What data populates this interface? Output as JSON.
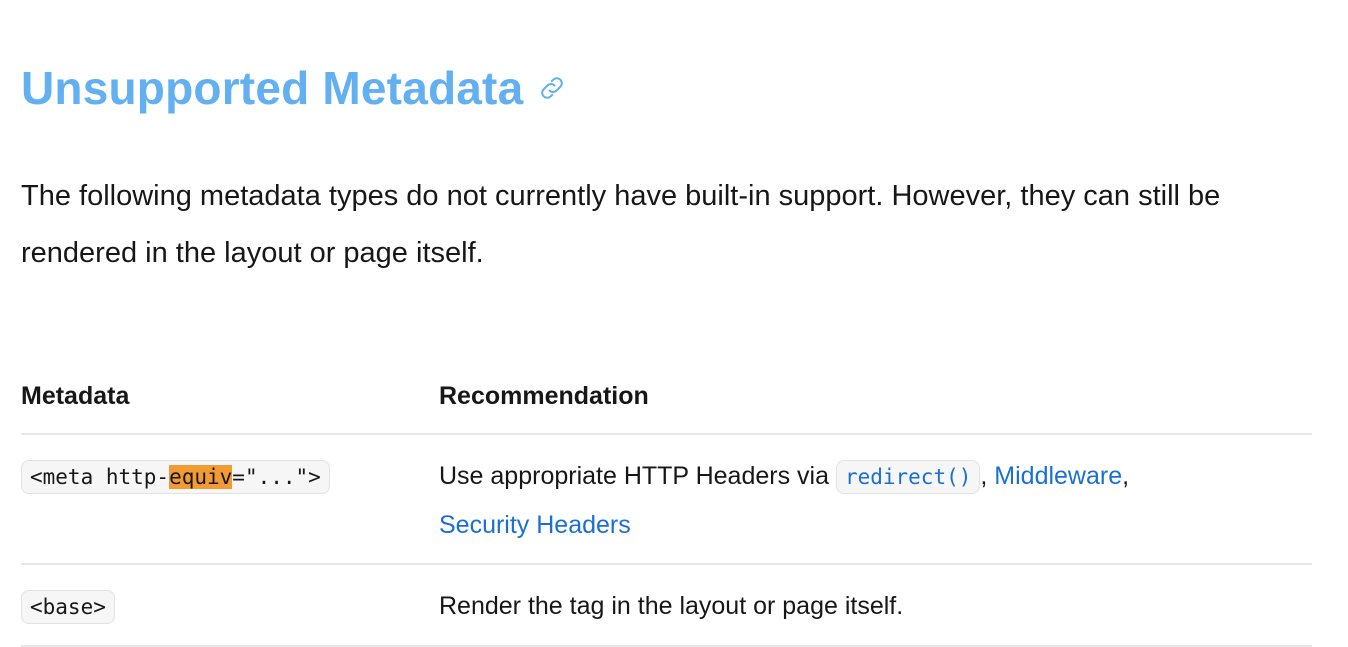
{
  "section": {
    "title": "Unsupported Metadata",
    "anchor_icon": "link-icon",
    "intro": "The following metadata types do not currently have built-in support. However, they can still be rendered in the layout or page itself."
  },
  "table": {
    "headers": [
      "Metadata",
      "Recommendation"
    ],
    "rows": [
      {
        "tag_prefix": "<meta http-",
        "tag_highlight": "equiv",
        "tag_suffix": "=\"...\">",
        "rec_text": "Use appropriate HTTP Headers via ",
        "rec_code": "redirect()",
        "rec_sep": ", ",
        "rec_link1": "Middleware",
        "rec_comma": ",",
        "rec_link2": "Security Headers"
      },
      {
        "tag": "<base>",
        "rec_text": "Render the tag in the layout or page itself."
      }
    ]
  },
  "colors": {
    "heading": "#62aff1",
    "link": "#1a6fd4",
    "highlight": "#f29b34"
  }
}
